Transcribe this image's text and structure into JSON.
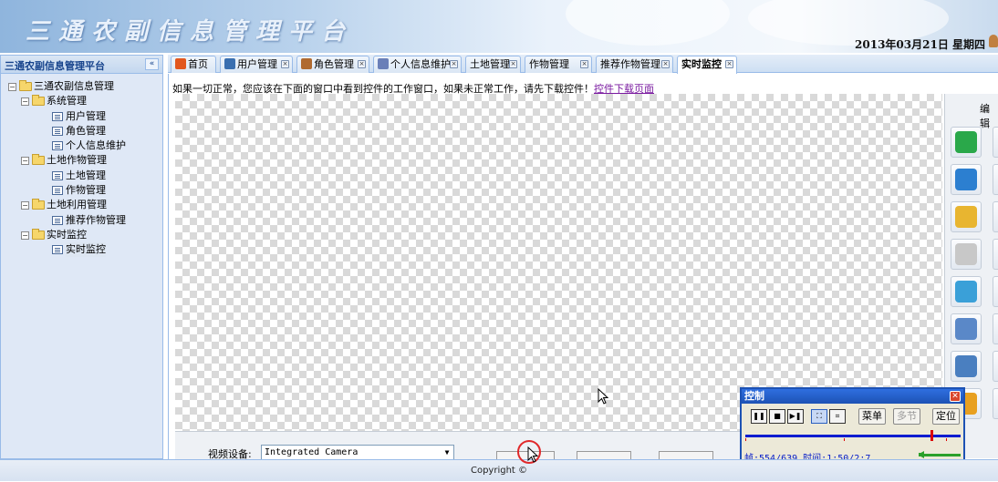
{
  "banner": {
    "title": "三通农副信息管理平台",
    "date": "2013年03月21日  星期四"
  },
  "left_panel": {
    "title": "三通农副信息管理平台",
    "collapse_glyph": "«",
    "tree": [
      {
        "label": "三通农副信息管理",
        "type": "folder",
        "expanded": true
      },
      {
        "label": "系统管理",
        "type": "folder",
        "expanded": true
      },
      {
        "label": "用户管理",
        "type": "doc"
      },
      {
        "label": "角色管理",
        "type": "doc"
      },
      {
        "label": "个人信息维护",
        "type": "doc"
      },
      {
        "label": "土地作物管理",
        "type": "folder",
        "expanded": true
      },
      {
        "label": "土地管理",
        "type": "doc"
      },
      {
        "label": "作物管理",
        "type": "doc"
      },
      {
        "label": "土地利用管理",
        "type": "folder",
        "expanded": true
      },
      {
        "label": "推荐作物管理",
        "type": "doc"
      },
      {
        "label": "实时监控",
        "type": "folder",
        "expanded": true
      },
      {
        "label": "实时监控",
        "type": "doc",
        "selected": true
      }
    ]
  },
  "tabs": [
    {
      "label": "首页",
      "icon": "home-icon",
      "closable": false
    },
    {
      "label": "用户管理",
      "icon": "user-list-icon",
      "closable": true
    },
    {
      "label": "角色管理",
      "icon": "role-icon",
      "closable": true
    },
    {
      "label": "个人信息维护",
      "icon": "personal-info-icon",
      "closable": true
    },
    {
      "label": "土地管理",
      "icon": "",
      "closable": true
    },
    {
      "label": "作物管理",
      "icon": "",
      "closable": true
    },
    {
      "label": "推荐作物管理",
      "icon": "",
      "closable": true
    },
    {
      "label": "实时监控",
      "icon": "",
      "closable": true,
      "active": true
    }
  ],
  "content": {
    "notice_text": "如果一切正常，您应该在下面的窗口中看到控件的工作窗口，如果未正常工作，请先下载控件！",
    "notice_link": "控件下载页面",
    "device_label": "视频设备:",
    "device_value": "Integrated Camera",
    "edit_label": "编辑"
  },
  "toolbar_icons": [
    "redo-arrow-icon",
    "globe-icon",
    "note-icon",
    "scissors-icon",
    "zoom-icon",
    "grid-window-icon",
    "save-disk-icon",
    "puzzle-icon"
  ],
  "control_window": {
    "title": "控制",
    "close_glyph": "✕",
    "menu_label": "菜单",
    "multi_label": "多节",
    "locate_label": "定位",
    "status": "帧:554/639 时间:1:50/2:7"
  },
  "footer": {
    "copyright": "Copyright ©"
  },
  "colors": {
    "accent": "#99bbe8",
    "title_blue": "#15428b",
    "control_title": "#1d52b4",
    "track": "#0a1cd0",
    "marker": "#dd0000"
  }
}
